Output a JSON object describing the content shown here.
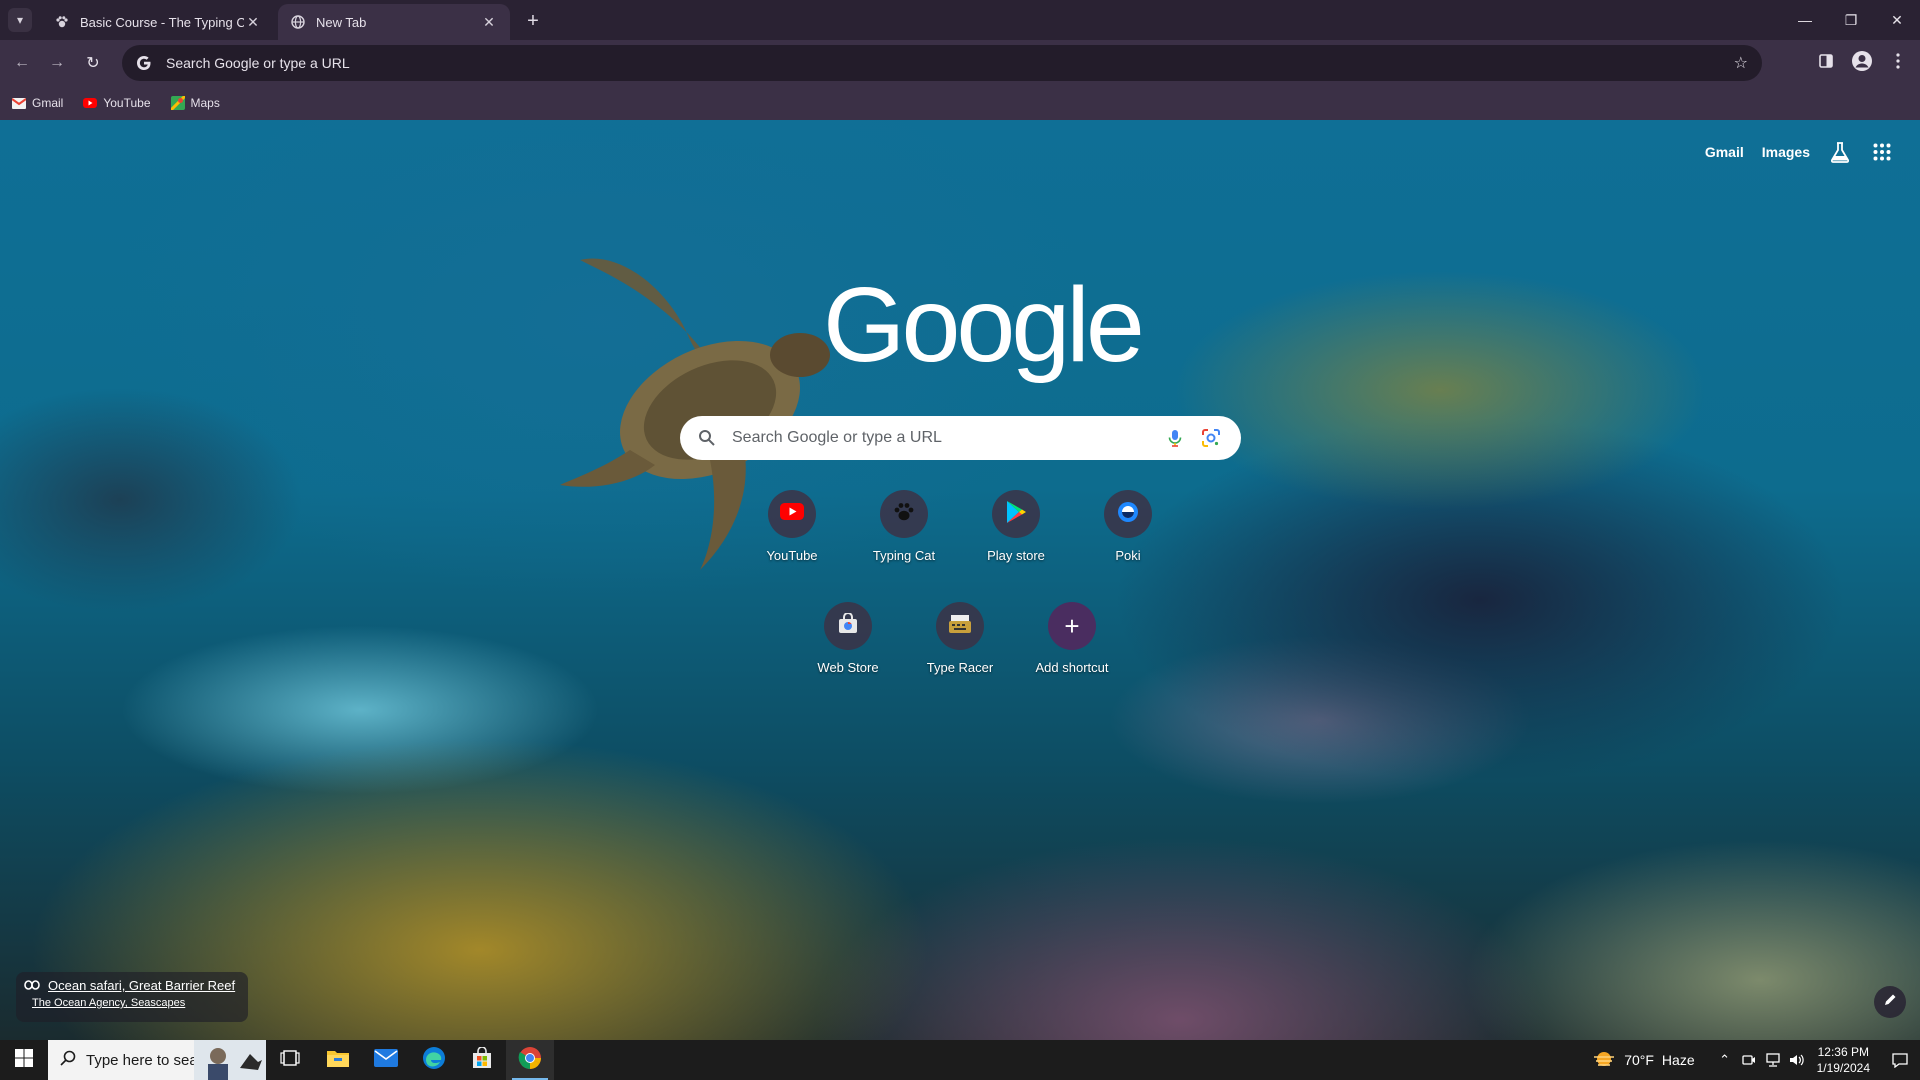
{
  "browser": {
    "tabs": [
      {
        "label": "Basic Course - The Typing Cat",
        "active": false
      },
      {
        "label": "New Tab",
        "active": true
      }
    ],
    "omnibox": {
      "text": "Search Google or type a URL"
    },
    "bookmarks": [
      {
        "label": "Gmail",
        "icon": "gmail-icon"
      },
      {
        "label": "YouTube",
        "icon": "youtube-icon"
      },
      {
        "label": "Maps",
        "icon": "maps-icon"
      }
    ]
  },
  "ntp": {
    "top_links": {
      "gmail": "Gmail",
      "images": "Images"
    },
    "logo_text": "Google",
    "search": {
      "placeholder": "Search Google or type a URL"
    },
    "shortcuts": [
      {
        "label": "YouTube",
        "icon": "youtube-icon"
      },
      {
        "label": "Typing Cat",
        "icon": "paw-icon"
      },
      {
        "label": "Play store",
        "icon": "play-store-icon"
      },
      {
        "label": "Poki",
        "icon": "poki-icon"
      },
      {
        "label": "Web Store",
        "icon": "web-store-icon"
      },
      {
        "label": "Type Racer",
        "icon": "type-racer-icon"
      },
      {
        "label": "Add shortcut",
        "icon": "plus-icon"
      }
    ],
    "attribution": {
      "title": "Ocean safari, Great Barrier Reef",
      "credit": "The Ocean Agency, Seascapes"
    }
  },
  "taskbar": {
    "search_placeholder": "Type here to search",
    "weather": {
      "temp": "70°F",
      "condition": "Haze"
    },
    "clock": {
      "time": "12:36 PM",
      "date": "1/19/2024"
    }
  },
  "colors": {
    "tab_strip": "#2a2233",
    "toolbar": "#3b3046",
    "omnibox": "#231c2a",
    "taskbar": "#1c1c1c",
    "accent": "#76b9ed"
  }
}
